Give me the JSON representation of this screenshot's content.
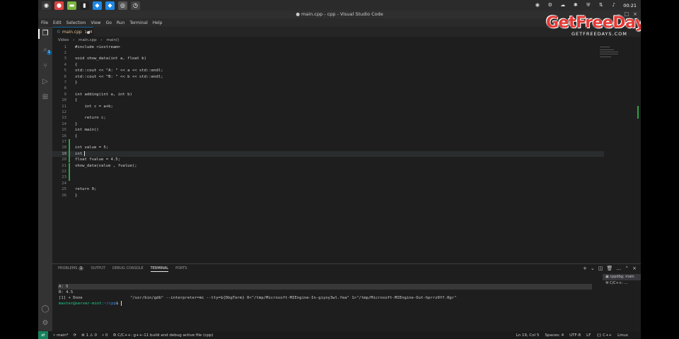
{
  "taskbar": {
    "apps": [
      {
        "icon": "mint-menu-icon",
        "glyph": "◉",
        "color": "#3a3a3a"
      },
      {
        "icon": "chrome-icon",
        "glyph": "●",
        "color": "#d44"
      },
      {
        "icon": "files-icon",
        "glyph": "▬",
        "color": "#7cb342"
      },
      {
        "icon": "terminal-icon",
        "glyph": "▮",
        "color": "#222"
      },
      {
        "icon": "vscode-icon",
        "glyph": "◆",
        "color": "#1e88e5"
      },
      {
        "icon": "vscode-icon",
        "glyph": "◆",
        "color": "#1e88e5"
      },
      {
        "icon": "obs-icon",
        "glyph": "◎",
        "color": "#555"
      },
      {
        "icon": "timeshift-icon",
        "glyph": "◷",
        "color": "#444"
      }
    ],
    "clock": "00:21"
  },
  "window": {
    "title": "● main.cpp - cpp - Visual Studio Code"
  },
  "menubar": {
    "items": [
      "File",
      "Edit",
      "Selection",
      "View",
      "Go",
      "Run",
      "Terminal",
      "Help"
    ]
  },
  "tab": {
    "label": "main.cpp",
    "badge": "1, M"
  },
  "breadcrumb": {
    "items": [
      "Video",
      "main.cpp",
      "main()"
    ]
  },
  "code_lines": [
    "#include <iostream>",
    "",
    "void show_data(int a, float b)",
    "{",
    "std::cout << \"A: \" << a << std::endl;",
    "std::cout << \"B: \" << b << std::endl;",
    "}",
    "",
    "int adding(int a, int b)",
    "{",
    "    int c = a+b;",
    "",
    "    return c;",
    "}",
    "int main()",
    "{",
    "",
    "int value = 5;",
    "int ",
    "float fvalue = 4.5;",
    "show_data(value , fvalue);",
    "",
    "",
    "",
    "return 0;",
    "}"
  ],
  "line_numbers": [
    "1",
    "2",
    "3",
    "4",
    "5",
    "6",
    "7",
    "8",
    "9",
    "10",
    "11",
    "12",
    "13",
    "14",
    "15",
    "16",
    "17",
    "18",
    "19",
    "20",
    "21",
    "22",
    "23",
    "24",
    "25",
    "26"
  ],
  "panel": {
    "tabs": [
      "PROBLEMS",
      "OUTPUT",
      "DEBUG CONSOLE",
      "TERMINAL",
      "PORTS"
    ],
    "problems_count": "1",
    "terminal_lines": [
      "A: 5",
      "B: 4.5",
      "[1] + Done                    \"/usr/bin/gdb\" --interpreter=mi --tty=${DbgTerm} 0<\"/tmp/Microsoft-MIEngine-In-giyxy3wl.fea\" 1>\"/tmp/Microsoft-MIEngine-Out-hprrz0ff.0gr\""
    ],
    "prompt_user": "master@server-mint",
    "prompt_path": ":~/cpp",
    "prompt_suffix": "$ ",
    "terminal_list": [
      "cppdbg: main",
      "C/C++: ..."
    ]
  },
  "statusbar": {
    "branch": "main*",
    "sync": "⟳",
    "errors": "⊗ 1 ⚠ 0",
    "ports": "⑂ 0",
    "task": "⚙ C/C++: g++-11 build and debug active file (cpp)",
    "position": "Ln 19, Col 5",
    "spaces": "Spaces: 4",
    "encoding": "UTF-8",
    "eol": "LF",
    "language": "{} C++",
    "os": "Linux"
  },
  "watermark": {
    "main": "GetFreeDays",
    "sub": "GETFREEDAYS.COM"
  }
}
